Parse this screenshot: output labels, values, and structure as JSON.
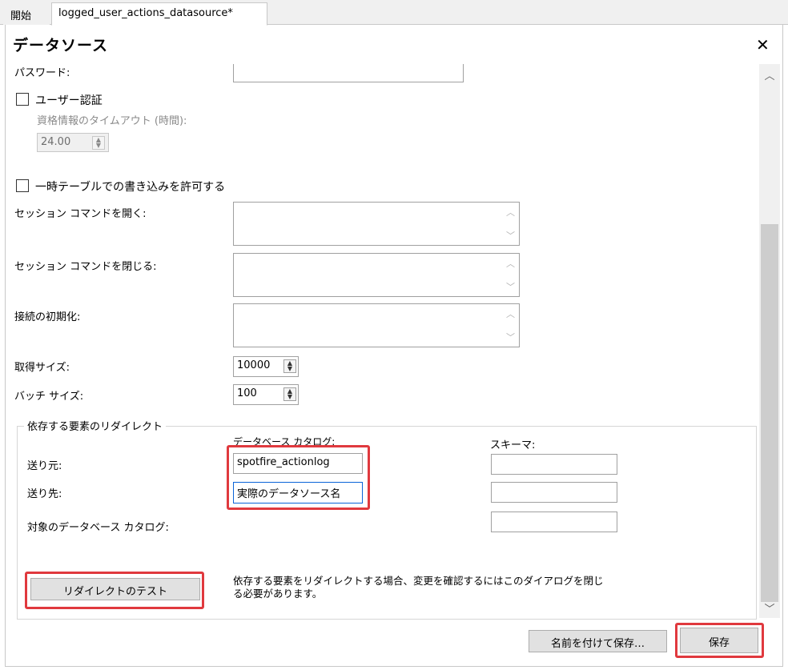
{
  "tabs": [
    {
      "label": "開始"
    },
    {
      "label": "logged_user_actions_datasource*"
    }
  ],
  "dialog": {
    "title": "データソース",
    "close_symbol": "✕"
  },
  "form": {
    "password_label": "パスワード:",
    "password_value": "",
    "user_auth_label": "ユーザー認証",
    "user_auth_checked": false,
    "credential_timeout_label": "資格情報のタイムアウト (時間):",
    "credential_timeout_value": "24.00",
    "allow_temp_tables_label": "一時テーブルでの書き込みを許可する",
    "allow_temp_tables_checked": false,
    "open_session_label": "セッション コマンドを開く:",
    "close_session_label": "セッション コマンドを閉じる:",
    "connection_init_label": "接続の初期化:",
    "fetch_size_label": "取得サイズ:",
    "fetch_size_value": "10000",
    "batch_size_label": "バッチ サイズ:",
    "batch_size_value": "100"
  },
  "redirect": {
    "group_label": "依存する要素のリダイレクト",
    "db_catalog_header": "データベース カタログ:",
    "schema_header": "スキーマ:",
    "from_label": "送り元:",
    "from_catalog": "spotfire_actionlog",
    "from_schema": "",
    "to_label": "送り先:",
    "to_catalog": "実際のデータソース名",
    "to_schema": "",
    "target_catalog_label": "対象のデータベース カタログ:",
    "target_catalog_value": "",
    "test_button": "リダイレクトのテスト",
    "note": "依存する要素をリダイレクトする場合、変更を確認するにはこのダイアログを閉じる必要があります。"
  },
  "footer": {
    "save_as_button": "名前を付けて保存…",
    "save_button": "保存"
  },
  "colors": {
    "highlight": "#e0393e",
    "scroll_thumb": "#cdcdcd"
  }
}
